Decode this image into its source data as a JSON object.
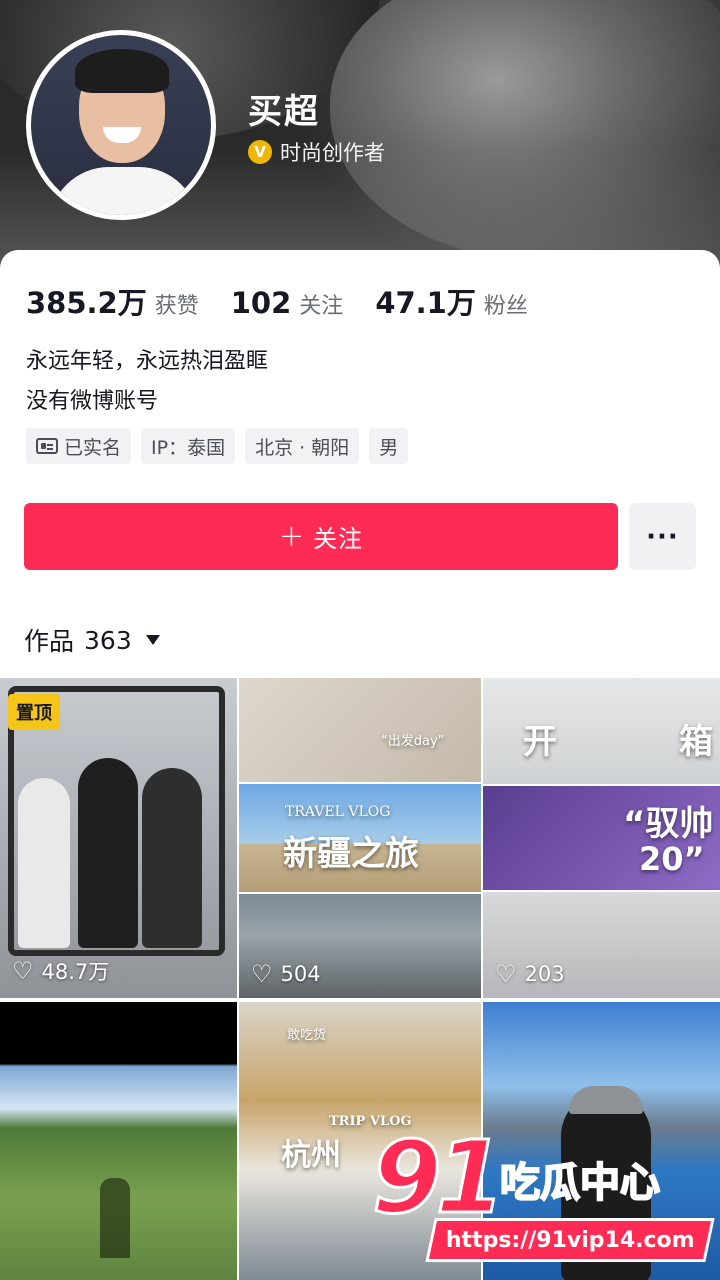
{
  "profile": {
    "name": "买超",
    "badge_letter": "V",
    "creator_label": "时尚创作者"
  },
  "stats": [
    {
      "value": "385.2万",
      "label": "获赞"
    },
    {
      "value": "102",
      "label": "关注"
    },
    {
      "value": "47.1万",
      "label": "粉丝"
    }
  ],
  "bio": {
    "line1": "永远年轻，永远热泪盈眶",
    "line2": "没有微博账号"
  },
  "tags": {
    "verified": "已实名",
    "ip": "IP：泰国",
    "location": "北京 · 朝阳",
    "gender": "男"
  },
  "actions": {
    "follow_plus": "+",
    "follow_label": "关注",
    "more_label": "···"
  },
  "works": {
    "label": "作品",
    "count": "363"
  },
  "videos": [
    {
      "pinned_label": "置顶",
      "likes": "48.7万"
    },
    {
      "caption_top": "“出发day”",
      "caption_main": "新疆之旅",
      "caption_sub": "TRAVEL VLOG",
      "likes": "504"
    },
    {
      "caption_left": "开",
      "caption_right": "箱",
      "caption_mid": "“驭帅",
      "caption_mid2": "20”",
      "likes": "203"
    },
    {},
    {
      "caption_main": "杭州",
      "caption_sub": "TRIP VLOG",
      "caption_tag": "敢吃货"
    },
    {}
  ],
  "watermark": {
    "logo_number": "91",
    "logo_text": "吃瓜中心",
    "url": "https://91vip14.com"
  },
  "colors": {
    "accent": "#fe2c55",
    "pin": "#f5c518"
  }
}
